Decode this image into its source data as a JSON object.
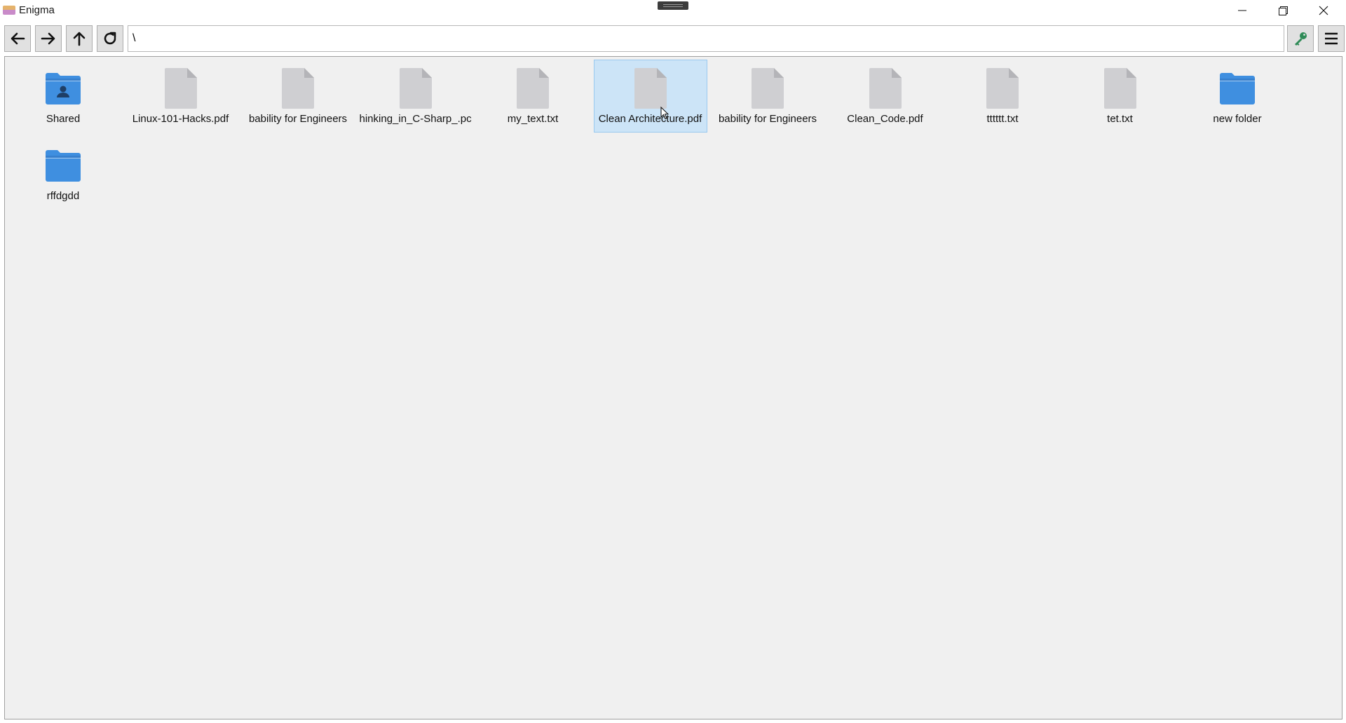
{
  "window": {
    "title": "Enigma"
  },
  "toolbar": {
    "back_icon": "arrow-left-icon",
    "forward_icon": "arrow-right-icon",
    "up_icon": "arrow-up-icon",
    "refresh_icon": "refresh-icon",
    "key_icon": "key-icon",
    "menu_icon": "hamburger-menu-icon",
    "path_value": "\\",
    "key_color": "#2e8b57"
  },
  "files": [
    {
      "label": "Shared",
      "type": "shared-folder"
    },
    {
      "label": "Linux-101-Hacks.pdf",
      "type": "file"
    },
    {
      "label": "bability for Engineers",
      "type": "file"
    },
    {
      "label": "hinking_in_C-Sharp_.pc",
      "type": "file"
    },
    {
      "label": "my_text.txt",
      "type": "file"
    },
    {
      "label": "Clean Architecture.pdf",
      "type": "file",
      "selected": true
    },
    {
      "label": "bability for Engineers",
      "type": "file"
    },
    {
      "label": "Clean_Code.pdf",
      "type": "file"
    },
    {
      "label": "tttttt.txt",
      "type": "file"
    },
    {
      "label": "tet.txt",
      "type": "file"
    },
    {
      "label": "new folder",
      "type": "folder"
    },
    {
      "label": "rffdgdd",
      "type": "folder"
    }
  ],
  "colors": {
    "folder": "#3f8fe0",
    "folder_tab": "#2f6fb8",
    "file": "#cfcfd2",
    "file_fold": "#b4b4b8",
    "selection": "#cce4f7"
  }
}
